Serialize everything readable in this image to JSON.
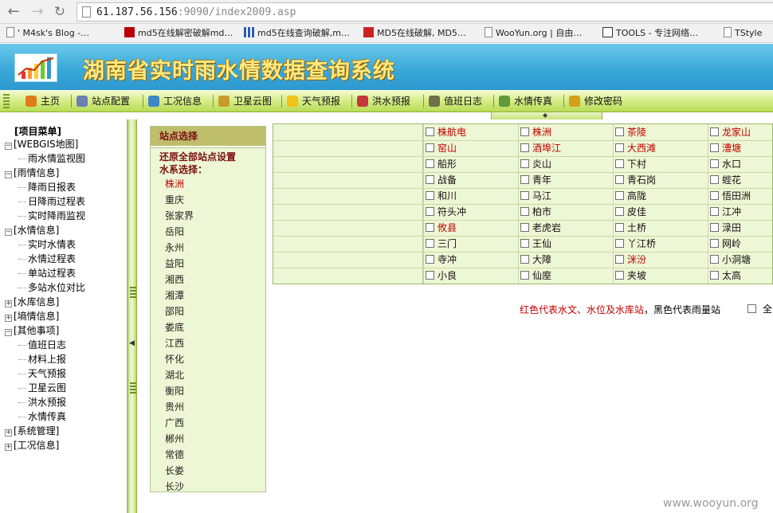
{
  "browser": {
    "url_host": "61.187.56.156",
    "url_rest": ":9090/index2009.asp",
    "bookmarks": [
      {
        "label": "' M4sk's Blog -…",
        "icon": "page-icon"
      },
      {
        "label": "md5在线解密破解md…",
        "icon": "x-icon"
      },
      {
        "label": "md5在线查询破解,m…",
        "icon": "grid-icon"
      },
      {
        "label": "MD5在线破解, MD5…",
        "icon": "code-icon"
      },
      {
        "label": "WooYun.org | 自由…",
        "icon": "page-icon"
      },
      {
        "label": "TOOLS - 专注网络…",
        "icon": "seven-icon"
      },
      {
        "label": "TStyle",
        "icon": "page-icon"
      }
    ]
  },
  "app": {
    "title": "湖南省实时雨水情数据查询系统"
  },
  "toolbar": [
    {
      "label": "主页",
      "icon": "home-icon",
      "color": "#e07b1a"
    },
    {
      "label": "站点配置",
      "icon": "wrench-icon",
      "color": "#6a7fb5"
    },
    {
      "label": "工况信息",
      "icon": "pencil-icon",
      "color": "#3c86c8"
    },
    {
      "label": "卫星云图",
      "icon": "satellite-icon",
      "color": "#c89a2a"
    },
    {
      "label": "天气预报",
      "icon": "sun-icon",
      "color": "#f2c21a"
    },
    {
      "label": "洪水预报",
      "icon": "car-icon",
      "color": "#c43a3a"
    },
    {
      "label": "值班日志",
      "icon": "book-icon",
      "color": "#6f6f4a"
    },
    {
      "label": "水情传真",
      "icon": "fax-icon",
      "color": "#5f9a3a"
    },
    {
      "label": "修改密码",
      "icon": "key-icon",
      "color": "#d4a017"
    }
  ],
  "sidebar": {
    "title": "[项目菜单]",
    "tree": [
      {
        "label": "[WEBGIS地图]",
        "level": 0,
        "toggle": "−"
      },
      {
        "label": "雨水情监视图",
        "level": 1
      },
      {
        "label": "[雨情信息]",
        "level": 0,
        "toggle": "−"
      },
      {
        "label": "降雨日报表",
        "level": 1
      },
      {
        "label": "日降雨过程表",
        "level": 1
      },
      {
        "label": "实时降雨监视",
        "level": 1
      },
      {
        "label": "[水情信息]",
        "level": 0,
        "toggle": "−"
      },
      {
        "label": "实时水情表",
        "level": 1
      },
      {
        "label": "水情过程表",
        "level": 1
      },
      {
        "label": "单站过程表",
        "level": 1
      },
      {
        "label": "多站水位对比",
        "level": 1
      },
      {
        "label": "[水库信息]",
        "level": 0,
        "toggle": "+"
      },
      {
        "label": "[墒情信息]",
        "level": 0,
        "toggle": "+"
      },
      {
        "label": "[其他事项]",
        "level": 0,
        "toggle": "−"
      },
      {
        "label": "值班日志",
        "level": 1
      },
      {
        "label": "材料上报",
        "level": 1
      },
      {
        "label": "天气预报",
        "level": 1
      },
      {
        "label": "卫星云图",
        "level": 1
      },
      {
        "label": "洪水预报",
        "level": 1
      },
      {
        "label": "水情传真",
        "level": 1
      },
      {
        "label": "[系统管理]",
        "level": 0,
        "toggle": "+"
      },
      {
        "label": "[工况信息]",
        "level": 0,
        "toggle": "+"
      }
    ]
  },
  "station_panel": {
    "title": "站点选择",
    "reset_label": "还原全部站点设置",
    "basin_label": "水系选择：",
    "basins": [
      "株洲",
      "重庆",
      "张家界",
      "岳阳",
      "永州",
      "益阳",
      "湘西",
      "湘潭",
      "邵阳",
      "娄底",
      "江西",
      "怀化",
      "湖北",
      "衡阳",
      "贵州",
      "广西",
      "郴州",
      "常德",
      "长娄",
      "长沙"
    ],
    "selected_basin": "株洲"
  },
  "stations": [
    [
      {
        "name": "株航电",
        "red": true
      },
      {
        "name": "株洲",
        "red": true
      },
      {
        "name": "茶陵",
        "red": true
      },
      {
        "name": "龙家山",
        "red": true
      }
    ],
    [
      {
        "name": "窑山",
        "red": true
      },
      {
        "name": "酒埠江",
        "red": true
      },
      {
        "name": "大西滩",
        "red": true
      },
      {
        "name": "漕塘",
        "red": true
      }
    ],
    [
      {
        "name": "船形",
        "red": false
      },
      {
        "name": "炎山",
        "red": false
      },
      {
        "name": "下村",
        "red": false
      },
      {
        "name": "水口",
        "red": false
      }
    ],
    [
      {
        "name": "战备",
        "red": false
      },
      {
        "name": "青年",
        "red": false
      },
      {
        "name": "青石岗",
        "red": false
      },
      {
        "name": "蜌花",
        "red": false
      }
    ],
    [
      {
        "name": "和川",
        "red": false
      },
      {
        "name": "马江",
        "red": false
      },
      {
        "name": "高陇",
        "red": false
      },
      {
        "name": "悟田洲",
        "red": false
      }
    ],
    [
      {
        "name": "符头冲",
        "red": false
      },
      {
        "name": "柏市",
        "red": false
      },
      {
        "name": "皮佳",
        "red": false
      },
      {
        "name": "江冲",
        "red": false
      }
    ],
    [
      {
        "name": "攸县",
        "red": true
      },
      {
        "name": "老虎岩",
        "red": false
      },
      {
        "name": "土桥",
        "red": false
      },
      {
        "name": "渌田",
        "red": false
      }
    ],
    [
      {
        "name": "三门",
        "red": false
      },
      {
        "name": "王仙",
        "red": false
      },
      {
        "name": "丫江桥",
        "red": false
      },
      {
        "name": "网岭",
        "red": false
      }
    ],
    [
      {
        "name": "寺冲",
        "red": false
      },
      {
        "name": "大障",
        "red": false
      },
      {
        "name": "洣汾",
        "red": true
      },
      {
        "name": "小洞塘",
        "red": false
      }
    ],
    [
      {
        "name": "小良",
        "red": false
      },
      {
        "name": "仙庢",
        "red": false
      },
      {
        "name": "夹坡",
        "red": false
      },
      {
        "name": "太高",
        "red": false
      }
    ]
  ],
  "legend": {
    "red_part": "红色代表水文、水位及水库站",
    "black_part": "，黑色代表雨量站",
    "select_all": "全"
  },
  "watermark": "www.wooyun.org"
}
